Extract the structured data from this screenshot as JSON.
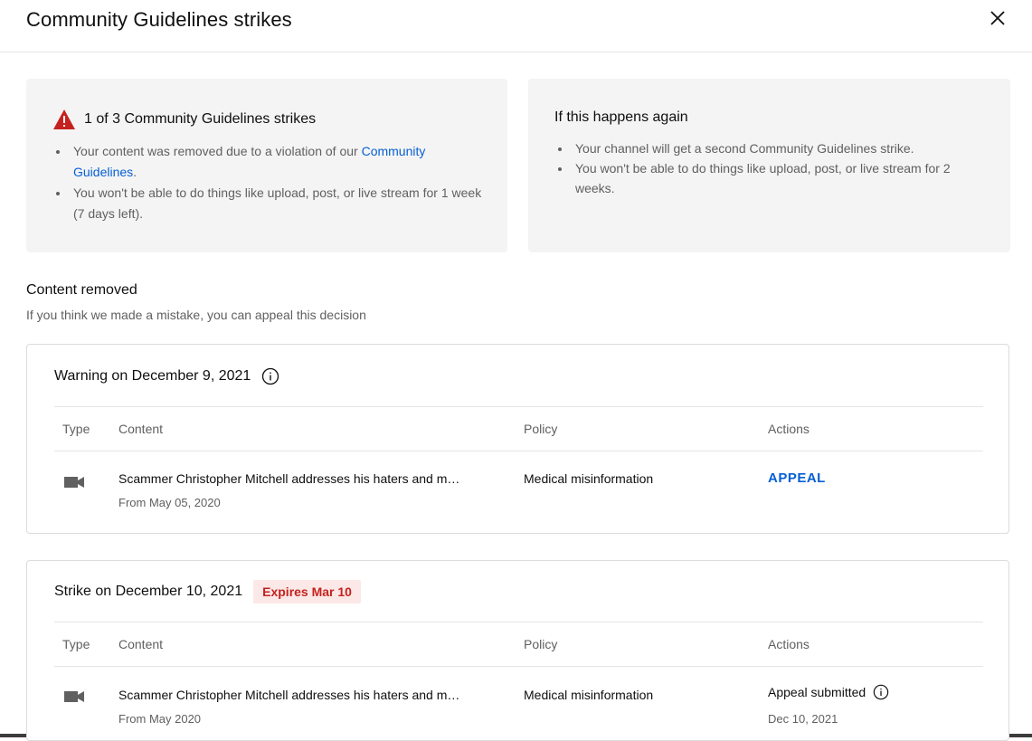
{
  "dialog": {
    "title": "Community Guidelines strikes"
  },
  "current": {
    "heading": "1 of 3 Community Guidelines strikes",
    "bullet1_prefix": "Your content was removed due to a violation of our ",
    "bullet1_link": "Community Guidelines",
    "bullet1_suffix": ".",
    "bullet2": "You won't be able to do things like upload, post, or live stream for 1 week (7 days left)."
  },
  "next": {
    "heading": "If this happens again",
    "bullet1": "Your channel will get a second Community Guidelines strike.",
    "bullet2": "You won't be able to do things like upload, post, or live stream for 2 weeks."
  },
  "content_removed": {
    "title": "Content removed",
    "subtitle": "If you think we made a mistake, you can appeal this decision"
  },
  "table_headers": {
    "type": "Type",
    "content": "Content",
    "policy": "Policy",
    "actions": "Actions"
  },
  "warning": {
    "heading": "Warning on December 9, 2021",
    "content_title": "Scammer Christopher Mitchell addresses his haters and m…",
    "content_date": "From May 05, 2020",
    "policy": "Medical misinformation",
    "action": "APPEAL"
  },
  "strike": {
    "heading": "Strike on December 10, 2021",
    "badge": "Expires Mar 10",
    "content_title": "Scammer Christopher Mitchell addresses his haters and m…",
    "content_date": "From May 2020",
    "policy": "Medical misinformation",
    "action": "Appeal submitted",
    "action_date": "Dec 10, 2021"
  },
  "colors": {
    "link": "#065fd4",
    "warning_red": "#c5221f",
    "badge_bg": "#fce8e6"
  }
}
